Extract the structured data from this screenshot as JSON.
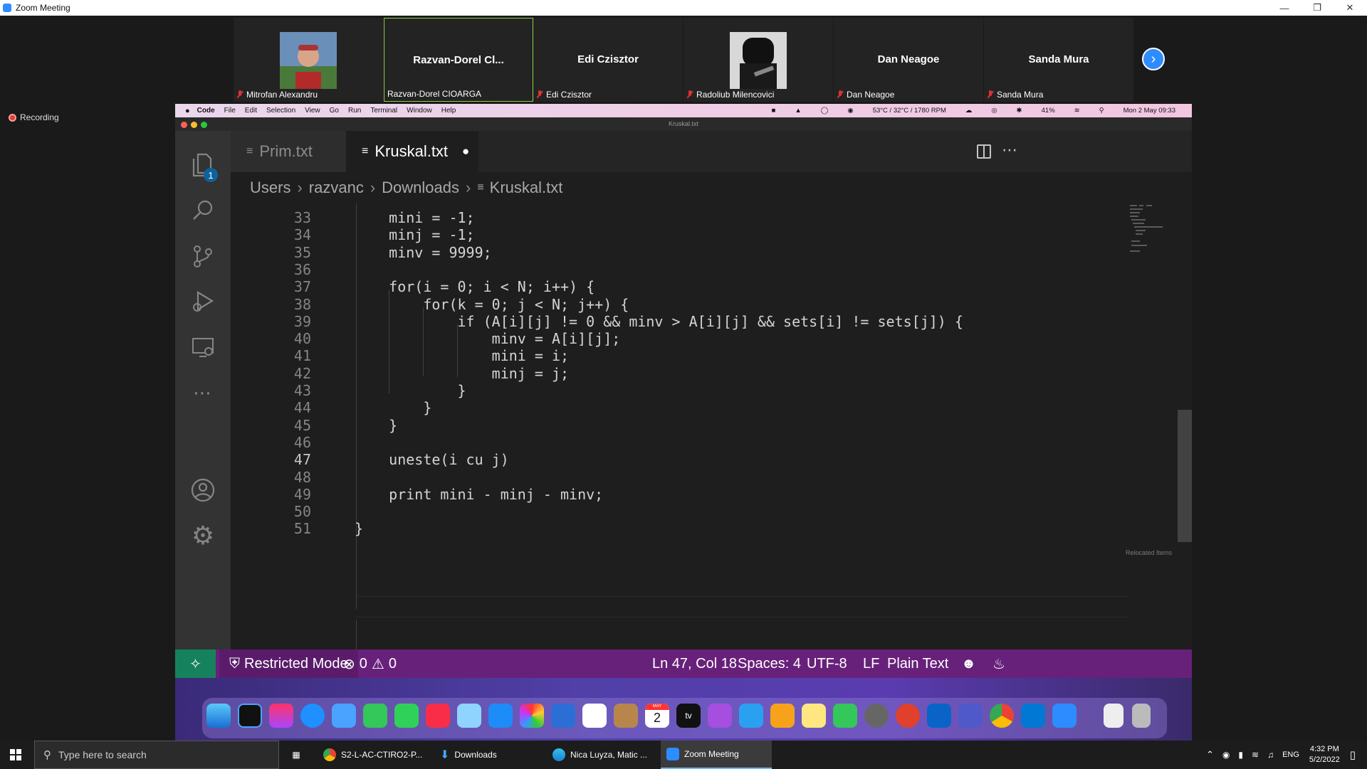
{
  "zoom": {
    "window_title": "Zoom Meeting",
    "participants": [
      {
        "big": "",
        "name": "Mitrofan Alexandru"
      },
      {
        "big": "Razvan-Dorel  Cl...",
        "name": "Razvan-Dorel CIOARGA"
      },
      {
        "big": "Edi Czisztor",
        "name": "Edi Czisztor"
      },
      {
        "big": "",
        "name": "Radoliub Milencovici"
      },
      {
        "big": "Dan Neagoe",
        "name": "Dan Neagoe"
      },
      {
        "big": "Sanda Mura",
        "name": "Sanda Mura"
      }
    ],
    "recording": "Recording"
  },
  "mac": {
    "menu": [
      "Code",
      "File",
      "Edit",
      "Selection",
      "View",
      "Go",
      "Run",
      "Terminal",
      "Window",
      "Help"
    ],
    "status_weather": "53°C / 32°C / 1780 RPM",
    "battery": "41%",
    "clock": "Mon 2 May  09:33"
  },
  "vscode": {
    "window_title": "Kruskal.txt",
    "explorer_badge": "1",
    "tabs": [
      {
        "label": "Prim.txt"
      },
      {
        "label": "Kruskal.txt"
      }
    ],
    "breadcrumb": [
      "Users",
      "razvanc",
      "Downloads",
      "Kruskal.txt"
    ],
    "lines": [
      {
        "n": "33",
        "code": "    mini = -1;"
      },
      {
        "n": "34",
        "code": "    minj = -1;"
      },
      {
        "n": "35",
        "code": "    minv = 9999;"
      },
      {
        "n": "36",
        "code": ""
      },
      {
        "n": "37",
        "code": "    for(i = 0; i < N; i++) {"
      },
      {
        "n": "38",
        "code": "        for(k = 0; j < N; j++) {"
      },
      {
        "n": "39",
        "code": "            if (A[i][j] != 0 && minv > A[i][j] && sets[i] != sets[j]) {"
      },
      {
        "n": "40",
        "code": "                minv = A[i][j];"
      },
      {
        "n": "41",
        "code": "                mini = i;"
      },
      {
        "n": "42",
        "code": "                minj = j;"
      },
      {
        "n": "43",
        "code": "            }"
      },
      {
        "n": "44",
        "code": "        }"
      },
      {
        "n": "45",
        "code": "    }"
      },
      {
        "n": "46",
        "code": ""
      },
      {
        "n": "47",
        "code": "    uneste(i cu j)"
      },
      {
        "n": "48",
        "code": ""
      },
      {
        "n": "49",
        "code": "    print mini - minj - minv;"
      },
      {
        "n": "50",
        "code": ""
      },
      {
        "n": "51",
        "code": "}"
      }
    ],
    "status": {
      "restricted": "Restricted Mode",
      "errors": "0",
      "warnings": "0",
      "position": "Ln 47, Col 18",
      "spaces": "Spaces: 4",
      "encoding": "UTF-8",
      "eol": "LF",
      "language": "Plain Text"
    },
    "relocated": "Relocated Items"
  },
  "dock": {
    "calendar_month": "MAY",
    "calendar_day": "2",
    "tv": "tv"
  },
  "taskbar": {
    "search_placeholder": "Type here to search",
    "apps": [
      {
        "label": "S2-L-AC-CTIRO2-P..."
      },
      {
        "label": "Downloads"
      },
      {
        "label": "Nica Luyza, Matic ..."
      },
      {
        "label": "Zoom Meeting"
      }
    ],
    "lang": "ENG",
    "time": "4:32 PM",
    "date": "5/2/2022"
  },
  "colors": {
    "vscode_status": "#68217a",
    "zoom_blue": "#2d8cff",
    "active_speaker": "#8bd24a"
  }
}
